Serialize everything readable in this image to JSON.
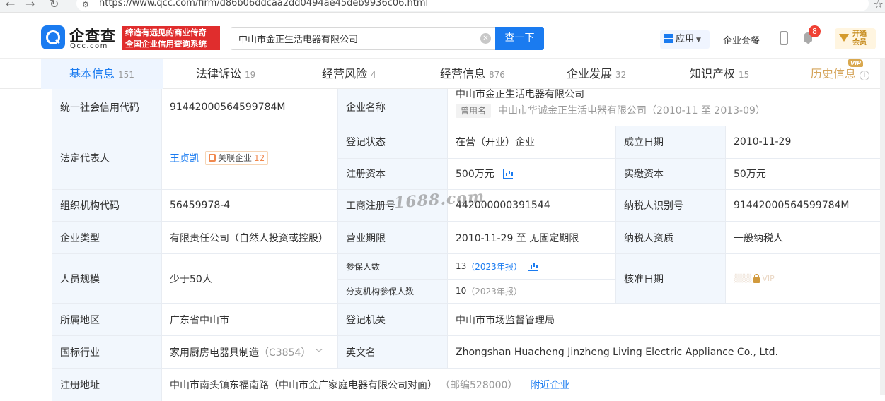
{
  "browser": {
    "url": "https://www.qcc.com/firm/d86b06ddcaa2dd0494ae45deb9936c06.html"
  },
  "header": {
    "logo_text": "企查查",
    "logo_sub": "Qcc.com",
    "slogan_line1": "缔造有远见的商业传奇",
    "slogan_line2": "全国企业信用查询系统",
    "search_value": "中山市金正生活电器有限公司",
    "search_button": "查一下",
    "app_menu": "应用",
    "package_link": "企业套餐",
    "notification_count": "8",
    "vip_line1": "开通",
    "vip_line2": "会员"
  },
  "tabs": [
    {
      "label": "基本信息",
      "count": "151"
    },
    {
      "label": "法律诉讼",
      "count": "19"
    },
    {
      "label": "经营风险",
      "count": "4"
    },
    {
      "label": "经营信息",
      "count": "876"
    },
    {
      "label": "企业发展",
      "count": "32"
    },
    {
      "label": "知识产权",
      "count": "15"
    },
    {
      "label": "历史信息",
      "count": ""
    }
  ],
  "vip_tag": "VIP",
  "info": {
    "credit_code_label": "统一社会信用代码",
    "credit_code": "91442000564599784M",
    "company_name_label": "企业名称",
    "company_name": "中山市金正生活电器有限公司",
    "former_name_tag": "曾用名",
    "former_name": "中山市华诚金正生活电器有限公司（2010-11 至 2013-09）",
    "legal_rep_label": "法定代表人",
    "legal_rep": "王贞凯",
    "related_label": "关联企业",
    "related_count": "12",
    "reg_status_label": "登记状态",
    "reg_status": "在营（开业）企业",
    "founded_label": "成立日期",
    "founded": "2010-11-29",
    "reg_capital_label": "注册资本",
    "reg_capital": "500万元",
    "paid_capital_label": "实缴资本",
    "paid_capital": "50万元",
    "org_code_label": "组织机构代码",
    "org_code": "56459978-4",
    "biz_reg_no_label": "工商注册号",
    "biz_reg_no": "442000000391544",
    "taxpayer_id_label": "纳税人识别号",
    "taxpayer_id": "91442000564599784M",
    "company_type_label": "企业类型",
    "company_type": "有限责任公司（自然人投资或控股）",
    "biz_term_label": "营业期限",
    "biz_term": "2010-11-29 至 无固定期限",
    "taxpayer_qual_label": "纳税人资质",
    "taxpayer_qual": "一般纳税人",
    "staff_size_label": "人员规模",
    "staff_size": "少于50人",
    "insured_label": "参保人数",
    "insured_count": "13",
    "insured_year": "（2023年报）",
    "branch_insured_label": "分支机构参保人数",
    "branch_insured_count": "10",
    "branch_insured_year": "（2023年报）",
    "approval_date_label": "核准日期",
    "approval_vip": "VIP",
    "region_label": "所属地区",
    "region": "广东省中山市",
    "reg_authority_label": "登记机关",
    "reg_authority": "中山市市场监督管理局",
    "industry_label": "国标行业",
    "industry": "家用厨房电器具制造",
    "industry_code": "（C3854）",
    "english_name_label": "英文名",
    "english_name": "Zhongshan Huacheng Jinzheng Living Electric Appliance Co., Ltd.",
    "address_label": "注册地址",
    "address": "中山市南头镇东福南路（中山市金广家庭电器有限公司对面）",
    "postcode": "（邮编528000）",
    "nearby_link": "附近企业"
  },
  "watermark": "1688.com",
  "colors": {
    "accent": "#1a7bf0",
    "label_bg": "#f2f7fd",
    "slogan_bg": "#e02d2d",
    "badge_red": "#f04134",
    "vip_gold": "#d9a84e"
  }
}
